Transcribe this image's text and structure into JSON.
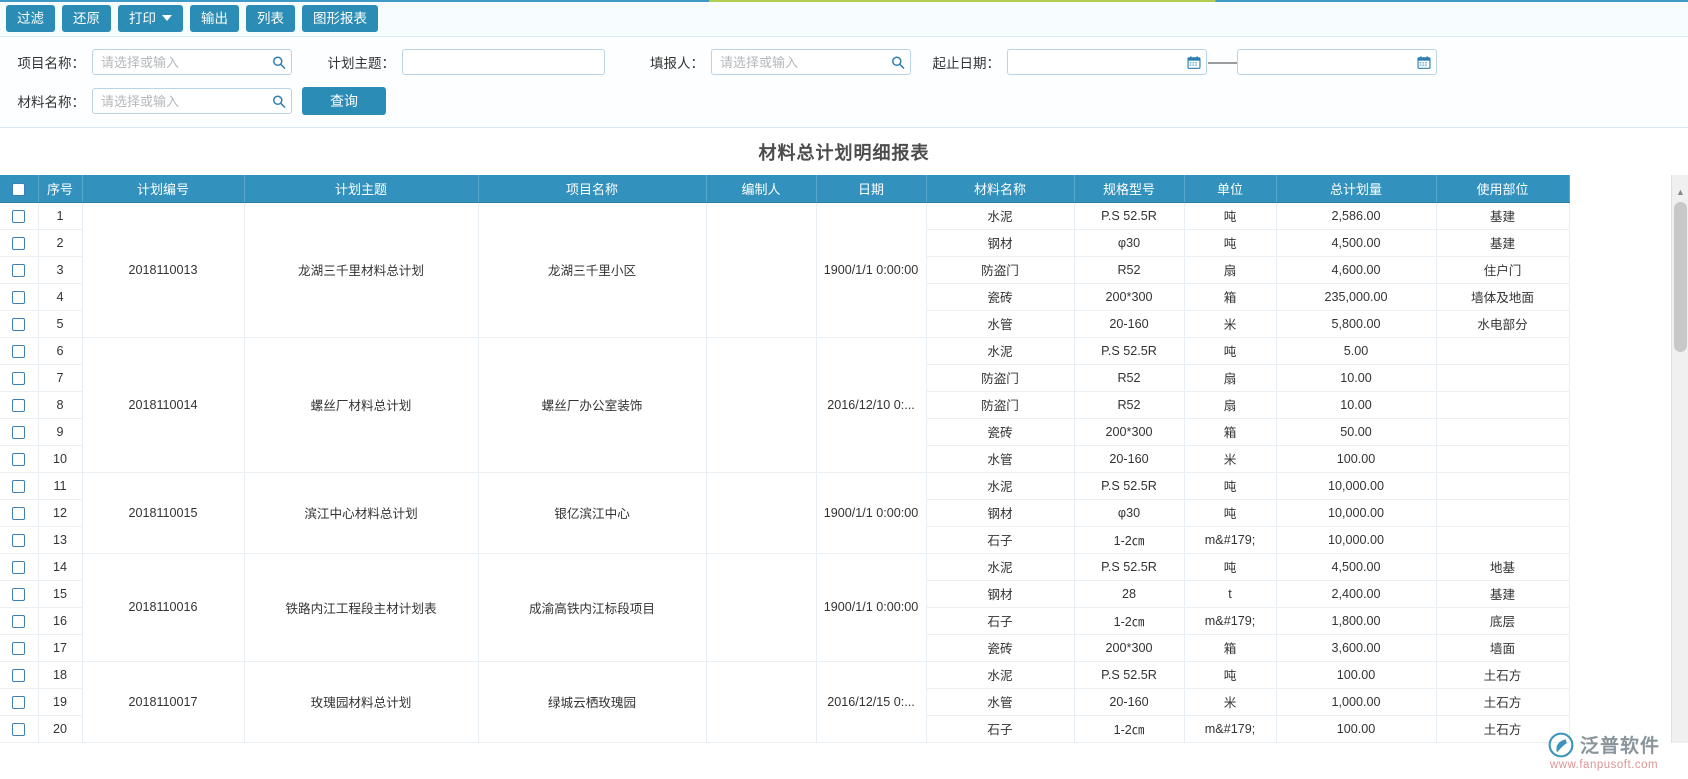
{
  "toolbar": {
    "buttons": [
      {
        "label": "过滤",
        "name": "filter-button",
        "caret": false
      },
      {
        "label": "还原",
        "name": "restore-button",
        "caret": false
      },
      {
        "label": "打印",
        "name": "print-button",
        "caret": true
      },
      {
        "label": "输出",
        "name": "export-button",
        "caret": false
      },
      {
        "label": "列表",
        "name": "list-button",
        "caret": false
      },
      {
        "label": "图形报表",
        "name": "chart-report-button",
        "caret": false
      }
    ]
  },
  "filters": {
    "project_name": {
      "label": "项目名称：",
      "value": "",
      "placeholder": "请选择或输入"
    },
    "plan_subject": {
      "label": "计划主题：",
      "value": "",
      "placeholder": ""
    },
    "reporter": {
      "label": "填报人：",
      "value": "",
      "placeholder": "请选择或输入"
    },
    "date_range": {
      "label": "起止日期：",
      "start_value": "",
      "end_value": "",
      "separator": "——"
    },
    "material_name": {
      "label": "材料名称：",
      "value": "",
      "placeholder": "请选择或输入"
    },
    "query_button": "查询"
  },
  "report": {
    "title": "材料总计划明细报表",
    "columns": [
      "",
      "序号",
      "计划编号",
      "计划主题",
      "项目名称",
      "编制人",
      "日期",
      "材料名称",
      "规格型号",
      "单位",
      "总计划量",
      "使用部位"
    ],
    "groups": [
      {
        "plan_no": "2018110013",
        "plan_subject": "龙湖三千里材料总计划",
        "project_name": "龙湖三千里小区",
        "author": "",
        "date": "1900/1/1 0:00:00",
        "rows": [
          {
            "idx": "1",
            "material": "水泥",
            "spec": "P.S 52.5R",
            "unit": "吨",
            "qty": "2,586.00",
            "site": "基建"
          },
          {
            "idx": "2",
            "material": "钢材",
            "spec": "φ30",
            "unit": "吨",
            "qty": "4,500.00",
            "site": "基建"
          },
          {
            "idx": "3",
            "material": "防盗门",
            "spec": "R52",
            "unit": "扇",
            "qty": "4,600.00",
            "site": "住户门"
          },
          {
            "idx": "4",
            "material": "瓷砖",
            "spec": "200*300",
            "unit": "箱",
            "qty": "235,000.00",
            "site": "墙体及地面"
          },
          {
            "idx": "5",
            "material": "水管",
            "spec": "20-160",
            "unit": "米",
            "qty": "5,800.00",
            "site": "水电部分"
          }
        ]
      },
      {
        "plan_no": "2018110014",
        "plan_subject": "螺丝厂材料总计划",
        "project_name": "螺丝厂办公室装饰",
        "author": "",
        "date": "2016/12/10 0:...",
        "rows": [
          {
            "idx": "6",
            "material": "水泥",
            "spec": "P.S 52.5R",
            "unit": "吨",
            "qty": "5.00",
            "site": ""
          },
          {
            "idx": "7",
            "material": "防盗门",
            "spec": "R52",
            "unit": "扇",
            "qty": "10.00",
            "site": ""
          },
          {
            "idx": "8",
            "material": "防盗门",
            "spec": "R52",
            "unit": "扇",
            "qty": "10.00",
            "site": ""
          },
          {
            "idx": "9",
            "material": "瓷砖",
            "spec": "200*300",
            "unit": "箱",
            "qty": "50.00",
            "site": ""
          },
          {
            "idx": "10",
            "material": "水管",
            "spec": "20-160",
            "unit": "米",
            "qty": "100.00",
            "site": ""
          }
        ]
      },
      {
        "plan_no": "2018110015",
        "plan_subject": "滨江中心材料总计划",
        "project_name": "银亿滨江中心",
        "author": "",
        "date": "1900/1/1 0:00:00",
        "rows": [
          {
            "idx": "11",
            "material": "水泥",
            "spec": "P.S 52.5R",
            "unit": "吨",
            "qty": "10,000.00",
            "site": ""
          },
          {
            "idx": "12",
            "material": "钢材",
            "spec": "φ30",
            "unit": "吨",
            "qty": "10,000.00",
            "site": ""
          },
          {
            "idx": "13",
            "material": "石子",
            "spec": "1-2㎝",
            "unit": "m&#179;",
            "qty": "10,000.00",
            "site": ""
          }
        ]
      },
      {
        "plan_no": "2018110016",
        "plan_subject": "铁路内江工程段主材计划表",
        "project_name": "成渝高铁内江标段项目",
        "author": "",
        "date": "1900/1/1 0:00:00",
        "rows": [
          {
            "idx": "14",
            "material": "水泥",
            "spec": "P.S 52.5R",
            "unit": "吨",
            "qty": "4,500.00",
            "site": "地基"
          },
          {
            "idx": "15",
            "material": "钢材",
            "spec": "28",
            "unit": "t",
            "qty": "2,400.00",
            "site": "基建"
          },
          {
            "idx": "16",
            "material": "石子",
            "spec": "1-2㎝",
            "unit": "m&#179;",
            "qty": "1,800.00",
            "site": "底层"
          },
          {
            "idx": "17",
            "material": "瓷砖",
            "spec": "200*300",
            "unit": "箱",
            "qty": "3,600.00",
            "site": "墙面"
          }
        ]
      },
      {
        "plan_no": "2018110017",
        "plan_subject": "玫瑰园材料总计划",
        "project_name": "绿城云栖玫瑰园",
        "author": "",
        "date": "2016/12/15 0:...",
        "rows": [
          {
            "idx": "18",
            "material": "水泥",
            "spec": "P.S 52.5R",
            "unit": "吨",
            "qty": "100.00",
            "site": "土石方"
          },
          {
            "idx": "19",
            "material": "水管",
            "spec": "20-160",
            "unit": "米",
            "qty": "1,000.00",
            "site": "土石方"
          },
          {
            "idx": "20",
            "material": "石子",
            "spec": "1-2㎝",
            "unit": "m&#179;",
            "qty": "100.00",
            "site": "土石方"
          }
        ]
      }
    ]
  },
  "watermark": {
    "brand": "泛普软件",
    "url": "www.fanpusoft.com"
  },
  "colors": {
    "accent": "#2b8cb5",
    "header": "#3291bd",
    "link": "#2030ee",
    "title": "#4c4c4c"
  }
}
